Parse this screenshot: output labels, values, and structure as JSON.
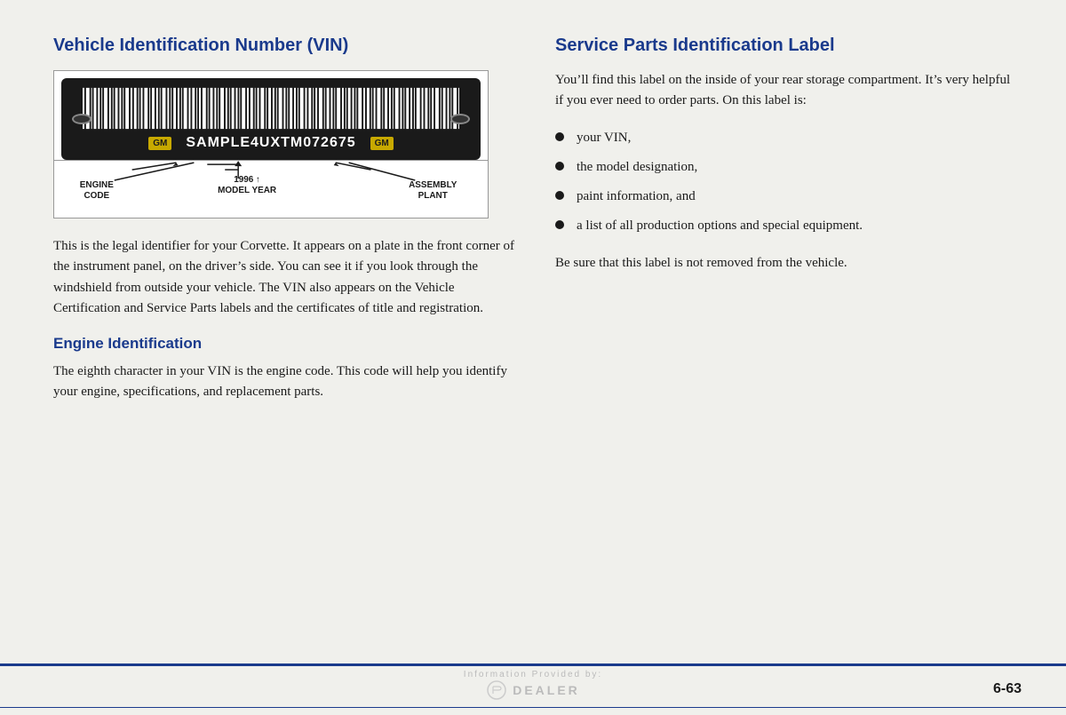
{
  "left": {
    "title": "Vehicle Identification Number (VIN)",
    "vin_sample": "SAMPLE4UXTM072675",
    "labels": {
      "engine_code": "ENGINE\nCODE",
      "model_year": "1996\nMODEL YEAR",
      "assembly_plant": "ASSEMBLY\nPLANT"
    },
    "body_paragraph": "This is the legal identifier for your Corvette. It appears on a plate in the front corner of the instrument panel, on the driver’s side. You can see it if you look through the windshield from outside your vehicle. The VIN also appears on the Vehicle Certification and Service Parts labels and the certificates of title and registration.",
    "engine_section": {
      "title": "Engine Identification",
      "body": "The eighth character in your VIN is the engine code. This code will help you identify your engine, specifications, and replacement parts."
    }
  },
  "right": {
    "title": "Service Parts Identification Label",
    "intro": "You’ll find this label on the inside of your rear storage compartment. It’s very helpful if you ever need to order parts. On this label is:",
    "bullets": [
      "your VIN,",
      "the model designation,",
      "paint information, and",
      "a list of all production options and special equipment."
    ],
    "closing": "Be sure that this label is not removed from the vehicle."
  },
  "footer": {
    "watermark_line1": "Information Provided by:",
    "watermark_line2": "DEALER",
    "page_number": "6-63"
  }
}
